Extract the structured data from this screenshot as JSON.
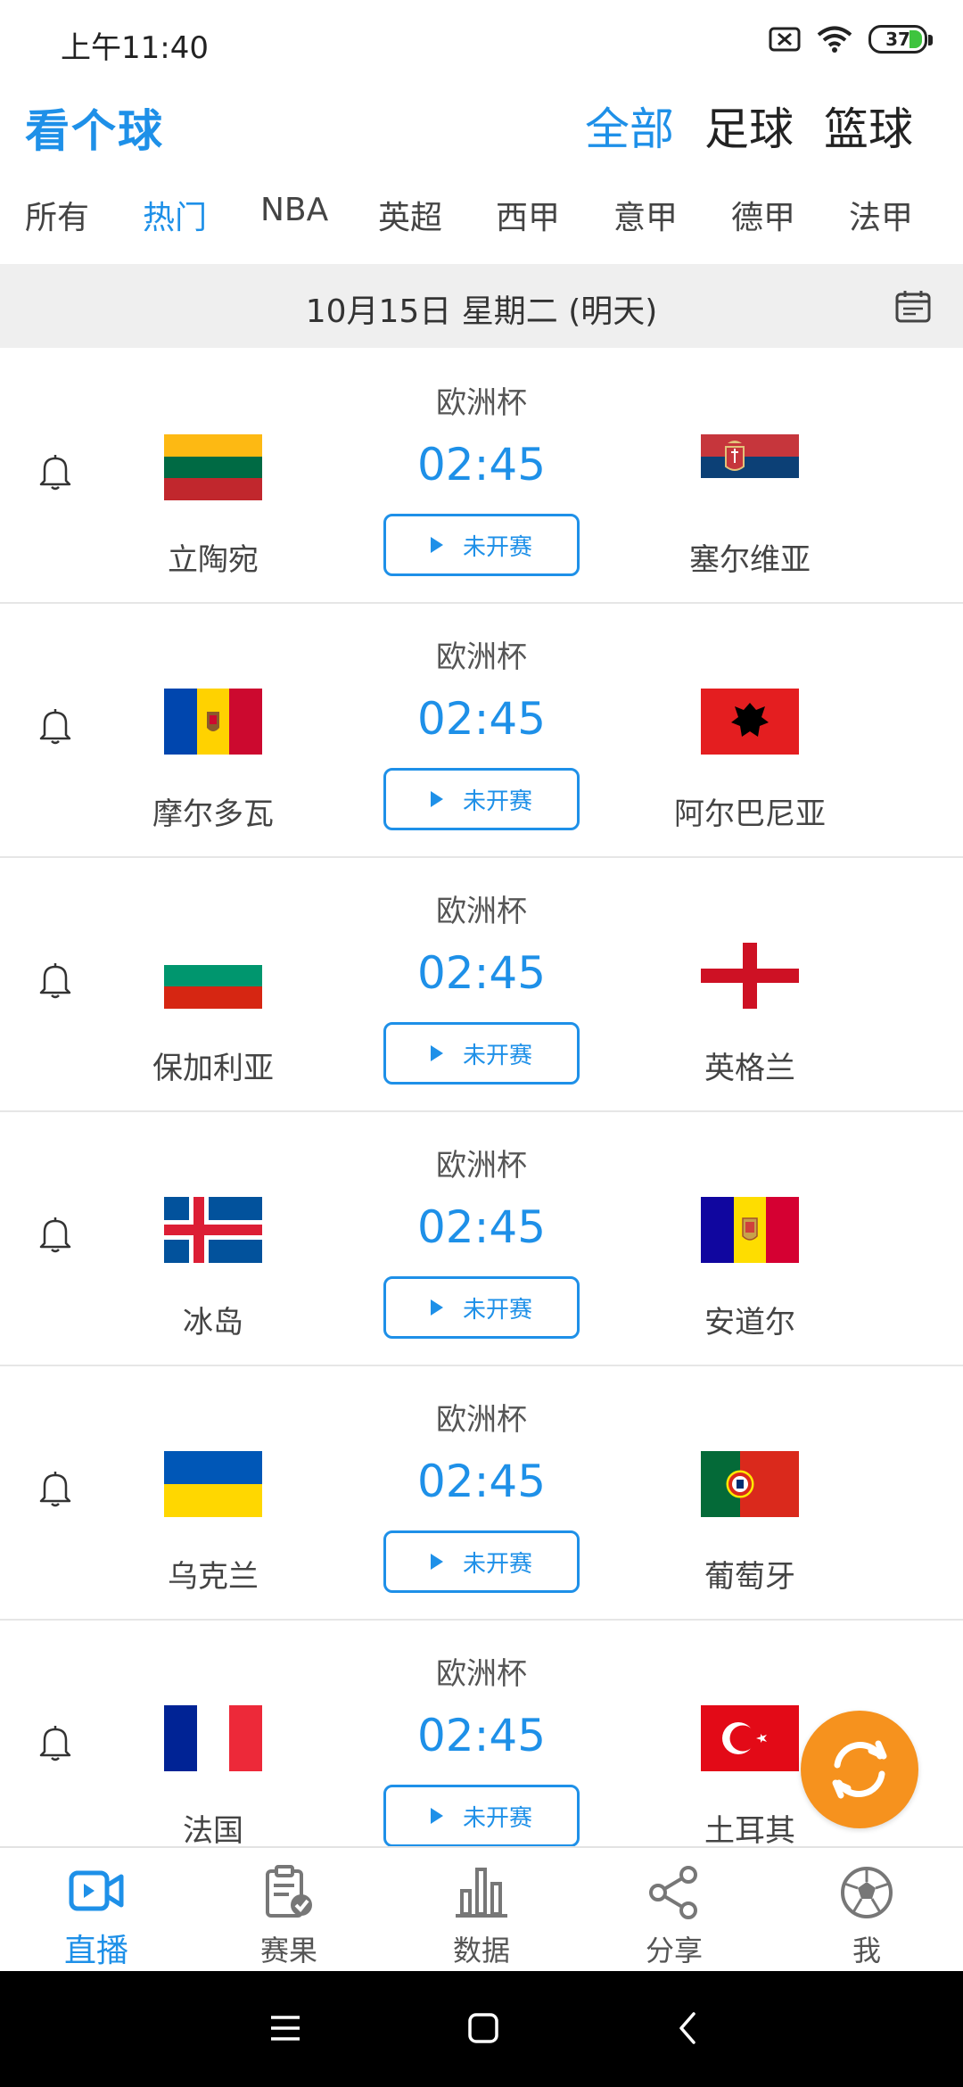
{
  "status_bar": {
    "time": "上午11:40",
    "battery": "37"
  },
  "app": {
    "logo": "看个球"
  },
  "sport_tabs": [
    {
      "label": "全部",
      "active": true
    },
    {
      "label": "足球",
      "active": false
    },
    {
      "label": "篮球",
      "active": false
    }
  ],
  "league_tabs": [
    {
      "label": "所有",
      "active": false
    },
    {
      "label": "热门",
      "active": true
    },
    {
      "label": "NBA",
      "active": false
    },
    {
      "label": "英超",
      "active": false
    },
    {
      "label": "西甲",
      "active": false
    },
    {
      "label": "意甲",
      "active": false
    },
    {
      "label": "德甲",
      "active": false
    },
    {
      "label": "法甲",
      "active": false
    }
  ],
  "date_bar": {
    "text": "10月15日 星期二 (明天)"
  },
  "matches": [
    {
      "league": "欧洲杯",
      "time": "02:45",
      "status": "未开赛",
      "home": "立陶宛",
      "away": "塞尔维亚",
      "home_flag": "lithuania-flag",
      "away_flag": "serbia-flag"
    },
    {
      "league": "欧洲杯",
      "time": "02:45",
      "status": "未开赛",
      "home": "摩尔多瓦",
      "away": "阿尔巴尼亚",
      "home_flag": "moldova-flag",
      "away_flag": "albania-flag"
    },
    {
      "league": "欧洲杯",
      "time": "02:45",
      "status": "未开赛",
      "home": "保加利亚",
      "away": "英格兰",
      "home_flag": "bulgaria-flag",
      "away_flag": "england-flag"
    },
    {
      "league": "欧洲杯",
      "time": "02:45",
      "status": "未开赛",
      "home": "冰岛",
      "away": "安道尔",
      "home_flag": "iceland-flag",
      "away_flag": "andorra-flag"
    },
    {
      "league": "欧洲杯",
      "time": "02:45",
      "status": "未开赛",
      "home": "乌克兰",
      "away": "葡萄牙",
      "home_flag": "ukraine-flag",
      "away_flag": "portugal-flag"
    },
    {
      "league": "欧洲杯",
      "time": "02:45",
      "status": "未开赛",
      "home": "法国",
      "away": "土耳其",
      "home_flag": "france-flag",
      "away_flag": "turkey-flag"
    }
  ],
  "bottom_nav": [
    {
      "label": "直播",
      "icon": "live-video-icon",
      "active": true
    },
    {
      "label": "赛果",
      "icon": "results-clipboard-icon",
      "active": false
    },
    {
      "label": "数据",
      "icon": "bar-chart-icon",
      "active": false
    },
    {
      "label": "分享",
      "icon": "share-icon",
      "active": false
    },
    {
      "label": "我",
      "icon": "soccer-ball-icon",
      "active": false
    }
  ],
  "colors": {
    "accent": "#1e90e8",
    "fab": "#f6921e",
    "date_bar_bg": "#efefef"
  }
}
